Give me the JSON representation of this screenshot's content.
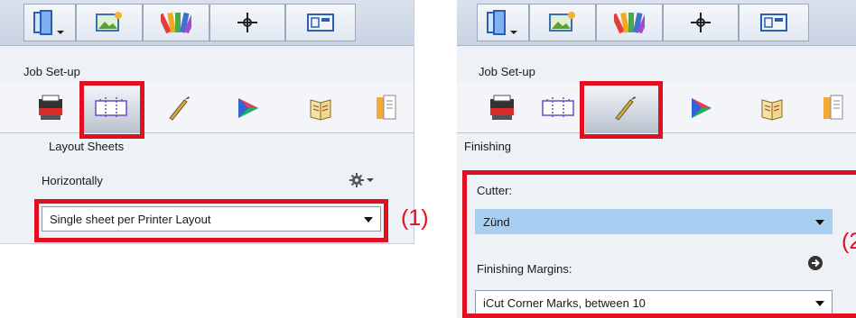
{
  "left_panel": {
    "section_label": "Job Set-up",
    "panel_title": "Layout Sheets",
    "field_label": "Horizontally",
    "dropdown_value": "Single sheet per Printer Layout",
    "callout": "(1)",
    "active_tab": "layout-sheets"
  },
  "right_panel": {
    "section_label": "Job Set-up",
    "panel_title": "Finishing",
    "cutter_label": "Cutter:",
    "cutter_value": "Zünd",
    "margins_label": "Finishing Margins:",
    "margins_value": "iCut Corner Marks, between 10",
    "callout": "(2",
    "active_tab": "finishing"
  },
  "toolbar_icons": [
    "job-folder-icon",
    "image-edit-icon",
    "color-swatches-icon",
    "target-crosshair-icon",
    "layout-window-icon"
  ],
  "tab_icons": [
    "printer-icon",
    "layout-sheets-icon",
    "finishing-knife-icon",
    "color-prism-icon",
    "book-pages-icon",
    "document-stack-icon"
  ],
  "colors": {
    "highlight_red": "#e01020",
    "selected_blue": "#a8cff2",
    "panel_bg": "#eef1f6"
  }
}
